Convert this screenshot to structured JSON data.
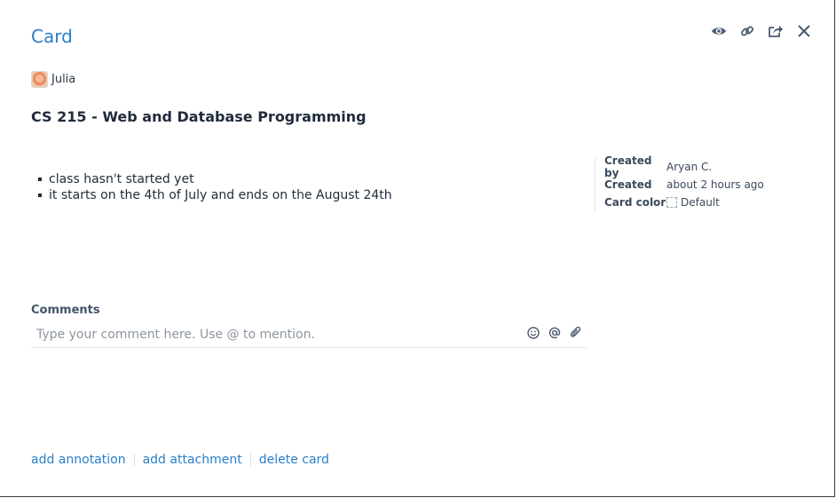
{
  "header": {
    "title": "Card",
    "icons": [
      "eye-icon",
      "link-icon",
      "share-icon",
      "close-icon"
    ]
  },
  "owner": {
    "name": "Julia"
  },
  "card": {
    "heading": "CS 215 - Web and Database Programming",
    "description": [
      "class hasn't started yet",
      "it starts on the 4th of July and ends on the August 24th"
    ]
  },
  "meta": {
    "created_by_label": "Created by",
    "created_by_value": "Aryan C.",
    "created_label": "Created",
    "created_value": "about 2 hours ago",
    "card_color_label": "Card color",
    "card_color_value": "Default"
  },
  "comments": {
    "label": "Comments",
    "placeholder": "Type your comment here. Use @ to mention.",
    "value": "",
    "tool_icons": [
      "smiley-icon",
      "at-icon",
      "paperclip-icon"
    ]
  },
  "footer": {
    "add_annotation": "add annotation",
    "add_attachment": "add attachment",
    "delete_card": "delete card"
  },
  "colors": {
    "accent": "#2a7fc9",
    "text": "#1f2b3b",
    "icon": "#4a5a6e"
  }
}
